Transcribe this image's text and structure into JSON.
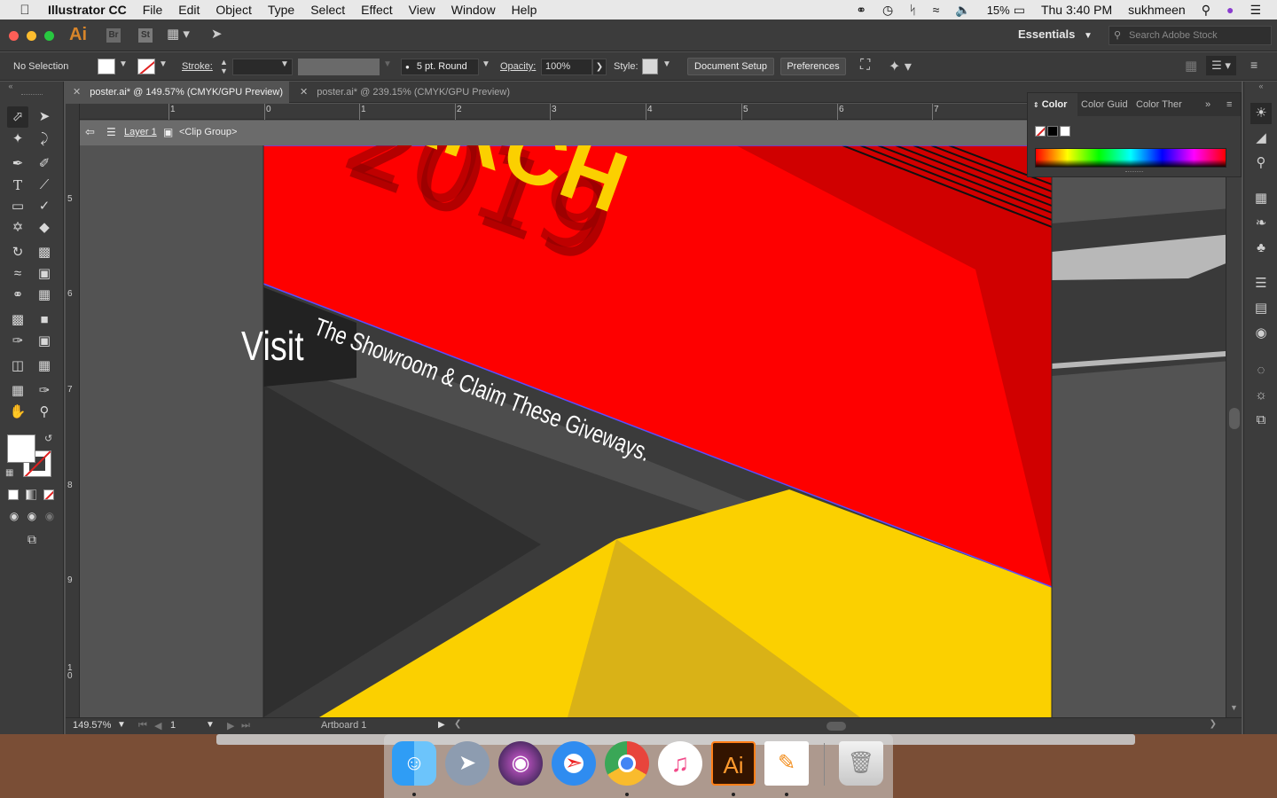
{
  "menubar": {
    "app_name": "Illustrator CC",
    "menus": [
      "File",
      "Edit",
      "Object",
      "Type",
      "Select",
      "Effect",
      "View",
      "Window",
      "Help"
    ],
    "battery": "15%",
    "clock": "Thu 3:40 PM",
    "user": "sukhmeen"
  },
  "appbar": {
    "logo": "Ai",
    "bridge": "Br",
    "stock": "St",
    "workspace": "Essentials",
    "search_placeholder": "Search Adobe Stock"
  },
  "controlbar": {
    "selection": "No Selection",
    "stroke_label": "Stroke:",
    "brush": "5 pt. Round",
    "opacity_label": "Opacity:",
    "opacity_value": "100%",
    "style_label": "Style:",
    "doc_setup": "Document Setup",
    "preferences": "Preferences"
  },
  "tabs": [
    {
      "label": "poster.ai* @ 149.57% (CMYK/GPU Preview)",
      "active": true
    },
    {
      "label": "poster.ai* @ 239.15% (CMYK/GPU Preview)",
      "active": false
    }
  ],
  "ruler": {
    "h_labels": [
      "1",
      "0",
      "1",
      "2",
      "3",
      "4",
      "5",
      "6",
      "7"
    ],
    "v_labels": [
      "5",
      "6",
      "7",
      "8",
      "9",
      "1\n0"
    ]
  },
  "breadcrumb": {
    "layer": "Layer 1",
    "group": "<Clip Group>"
  },
  "artwork": {
    "title_fragment": "ARCH",
    "year": "2019",
    "visit": "Visit",
    "tagline": "The Showroom & Claim These Giveways.",
    "colors": {
      "red": "#fe0000",
      "dark_red": "#d00000",
      "yellow": "#fbd000",
      "dark_yellow": "#d9b217",
      "dark_gray": "#3b3b3b",
      "mid_gray": "#4d4d4d"
    }
  },
  "color_panel": {
    "tabs": [
      "Color",
      "Color Guid",
      "Color Ther"
    ]
  },
  "statusbar": {
    "zoom": "149.57%",
    "artboard_index": "1",
    "artboard_name": "Artboard 1"
  },
  "dock": {
    "apps": [
      "Finder",
      "Launchpad",
      "Siri",
      "Safari",
      "Chrome",
      "iTunes",
      "Illustrator",
      "Pages",
      "Trash"
    ]
  }
}
